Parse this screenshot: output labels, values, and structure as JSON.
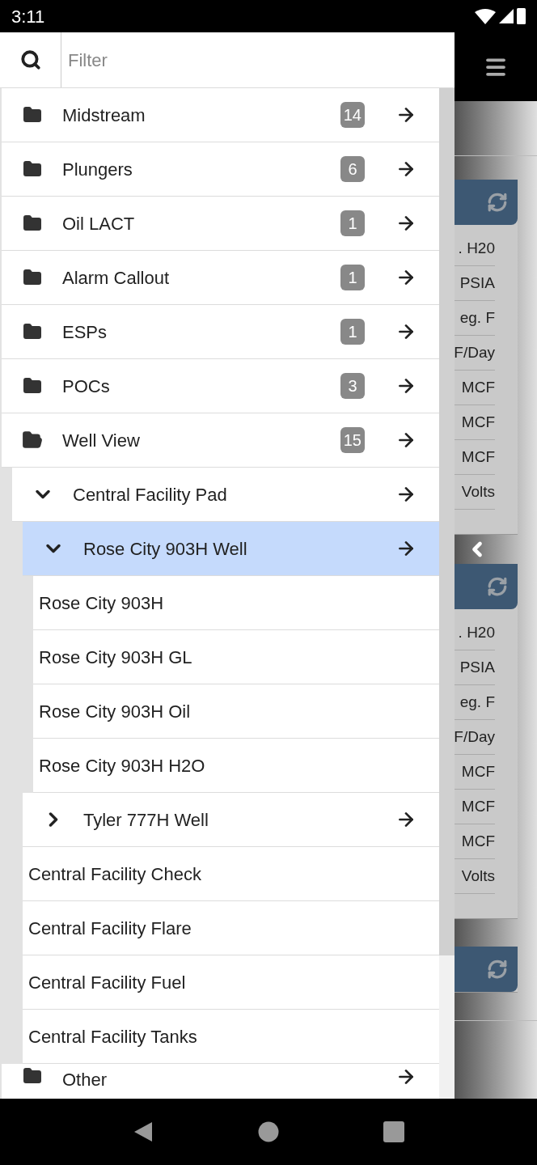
{
  "status_bar": {
    "time": "3:11"
  },
  "filter": {
    "placeholder": "Filter"
  },
  "tree": [
    {
      "kind": "folder",
      "label": "Midstream",
      "count": "14",
      "expanded": false,
      "selected": false
    },
    {
      "kind": "folder",
      "label": "Plungers",
      "count": "6",
      "expanded": false,
      "selected": false
    },
    {
      "kind": "folder",
      "label": "Oil LACT",
      "count": "1",
      "expanded": false,
      "selected": false
    },
    {
      "kind": "folder",
      "label": "Alarm Callout",
      "count": "1",
      "expanded": false,
      "selected": false
    },
    {
      "kind": "folder",
      "label": "ESPs",
      "count": "1",
      "expanded": false,
      "selected": false
    },
    {
      "kind": "folder",
      "label": "POCs",
      "count": "3",
      "expanded": false,
      "selected": false
    },
    {
      "kind": "folder",
      "label": "Well View",
      "count": "15",
      "expanded": true,
      "selected": false,
      "children": [
        {
          "kind": "group",
          "label": "Central Facility Pad",
          "expanded": true,
          "selected": false,
          "children": [
            {
              "kind": "group",
              "label": "Rose City 903H Well",
              "expanded": true,
              "selected": true,
              "children": [
                {
                  "kind": "leaf",
                  "label": "Rose City 903H",
                  "selected": false
                },
                {
                  "kind": "leaf",
                  "label": "Rose City 903H GL",
                  "selected": false
                },
                {
                  "kind": "leaf",
                  "label": "Rose City 903H Oil",
                  "selected": false
                },
                {
                  "kind": "leaf",
                  "label": "Rose City 903H H2O",
                  "selected": false
                }
              ]
            },
            {
              "kind": "group",
              "label": "Tyler 777H Well",
              "expanded": false,
              "selected": false
            },
            {
              "kind": "leaf",
              "label": "Central Facility Check",
              "selected": false
            },
            {
              "kind": "leaf",
              "label": "Central Facility Flare",
              "selected": false
            },
            {
              "kind": "leaf",
              "label": "Central Facility Fuel",
              "selected": false
            },
            {
              "kind": "leaf",
              "label": "Central Facility Tanks",
              "selected": false
            }
          ]
        }
      ]
    },
    {
      "kind": "folder",
      "label": "Other",
      "expanded": false,
      "selected": false
    }
  ],
  "background_cards": [
    {
      "kind": "expanded",
      "units": [
        ". H20",
        "PSIA",
        "eg. F",
        "F/Day",
        "MCF",
        "MCF",
        "MCF",
        "Volts"
      ]
    },
    {
      "kind": "expanded",
      "units": [
        ". H20",
        "PSIA",
        "eg. F",
        "F/Day",
        "MCF",
        "MCF",
        "MCF",
        "Volts"
      ]
    },
    {
      "kind": "collapsed"
    }
  ]
}
